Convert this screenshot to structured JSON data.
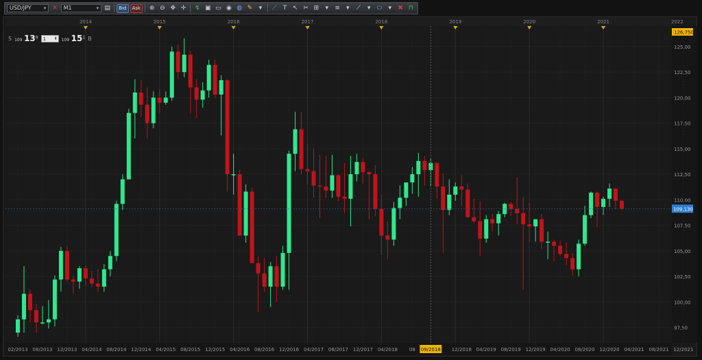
{
  "toolbar": {
    "symbol": "USD/JPY",
    "timeframe": "M1",
    "bid_label": "Bid",
    "ask_label": "Ask"
  },
  "price_panel": {
    "sell_label": "S",
    "sell_prefix": "109",
    "sell_big": "13",
    "sell_small": "9",
    "lots": "1",
    "buy_prefix": "109",
    "buy_big": "15",
    "buy_small": "1",
    "buy_label": "B"
  },
  "colors": {
    "bull": "#2ee88e",
    "bear": "#c0141b",
    "grid": "#2a2a2a",
    "current_price_tag": "#2f7fd0",
    "top_price_tag": "#f0b400",
    "cursor_date_tag": "#f0b400"
  },
  "chart_data": {
    "type": "candlestick",
    "timeframe": "monthly",
    "ylim": [
      96.0,
      127.0
    ],
    "y_ticks": [
      97.5,
      100.0,
      102.5,
      105.0,
      107.5,
      110.0,
      112.5,
      115.0,
      117.5,
      120.0,
      122.5,
      125.0
    ],
    "y_tick_labels": [
      "97,50",
      "100,00",
      "102,50",
      "105,00",
      "107,50",
      "110,00",
      "112,50",
      "115,00",
      "117,50",
      "120,00",
      "122,50",
      "125,00"
    ],
    "top_price_label": "126,750",
    "current_price": 109.13,
    "current_price_label": "109,130",
    "cursor_date_label": "09/2018",
    "year_labels": [
      "2014",
      "2015",
      "2016",
      "2017",
      "2018",
      "2019",
      "2020",
      "2021",
      "2022"
    ],
    "x_date_labels": [
      "02/2013",
      "08/2013",
      "12/2013",
      "04/2014",
      "08/2014",
      "12/2014",
      "04/2015",
      "08/2015",
      "12/2015",
      "04/2016",
      "08/2016",
      "12/2016",
      "04/2017",
      "08/2017",
      "12/2017",
      "04/2018",
      "08",
      "",
      "12/2018",
      "04/2019",
      "08/2019",
      "12/2019",
      "04/2020",
      "08/2020",
      "12/2020",
      "04/2021",
      "08/2021",
      "12/2021"
    ],
    "candles": [
      {
        "o": 97.0,
        "h": 98.7,
        "l": 96.6,
        "c": 98.3
      },
      {
        "o": 98.3,
        "h": 103.5,
        "l": 97.0,
        "c": 100.8
      },
      {
        "o": 100.8,
        "h": 101.2,
        "l": 98.0,
        "c": 99.2
      },
      {
        "o": 99.2,
        "h": 99.8,
        "l": 97.0,
        "c": 98.0
      },
      {
        "o": 98.0,
        "h": 99.6,
        "l": 97.8,
        "c": 98.0
      },
      {
        "o": 98.0,
        "h": 100.2,
        "l": 97.4,
        "c": 98.3
      },
      {
        "o": 98.3,
        "h": 102.6,
        "l": 97.6,
        "c": 102.2
      },
      {
        "o": 102.2,
        "h": 105.4,
        "l": 101.0,
        "c": 105.0
      },
      {
        "o": 105.0,
        "h": 105.5,
        "l": 102.0,
        "c": 102.2
      },
      {
        "o": 102.2,
        "h": 102.6,
        "l": 100.8,
        "c": 102.0
      },
      {
        "o": 102.0,
        "h": 103.5,
        "l": 101.3,
        "c": 103.3
      },
      {
        "o": 103.3,
        "h": 103.6,
        "l": 101.6,
        "c": 102.3
      },
      {
        "o": 102.3,
        "h": 103.0,
        "l": 101.5,
        "c": 101.8
      },
      {
        "o": 101.8,
        "h": 103.2,
        "l": 101.0,
        "c": 101.5
      },
      {
        "o": 101.5,
        "h": 103.7,
        "l": 101.0,
        "c": 103.2
      },
      {
        "o": 103.2,
        "h": 105.0,
        "l": 102.5,
        "c": 104.5
      },
      {
        "o": 104.5,
        "h": 109.9,
        "l": 104.0,
        "c": 109.6
      },
      {
        "o": 109.6,
        "h": 112.5,
        "l": 109.0,
        "c": 112.0
      },
      {
        "o": 112.0,
        "h": 118.9,
        "l": 112.0,
        "c": 118.5
      },
      {
        "o": 118.5,
        "h": 121.8,
        "l": 116.0,
        "c": 120.5
      },
      {
        "o": 120.5,
        "h": 121.7,
        "l": 118.1,
        "c": 119.3
      },
      {
        "o": 119.3,
        "h": 121.0,
        "l": 116.0,
        "c": 117.5
      },
      {
        "o": 117.5,
        "h": 120.6,
        "l": 117.0,
        "c": 120.0
      },
      {
        "o": 120.0,
        "h": 120.8,
        "l": 118.5,
        "c": 119.5
      },
      {
        "o": 119.5,
        "h": 120.6,
        "l": 119.3,
        "c": 120.0
      },
      {
        "o": 120.0,
        "h": 125.0,
        "l": 119.7,
        "c": 124.5
      },
      {
        "o": 124.5,
        "h": 125.2,
        "l": 121.8,
        "c": 122.5
      },
      {
        "o": 122.5,
        "h": 125.8,
        "l": 122.0,
        "c": 124.2
      },
      {
        "o": 124.2,
        "h": 124.6,
        "l": 118.5,
        "c": 121.0
      },
      {
        "o": 121.0,
        "h": 121.8,
        "l": 118.0,
        "c": 119.8
      },
      {
        "o": 119.8,
        "h": 121.5,
        "l": 119.0,
        "c": 120.7
      },
      {
        "o": 120.7,
        "h": 123.7,
        "l": 120.0,
        "c": 123.2
      },
      {
        "o": 123.2,
        "h": 123.7,
        "l": 120.0,
        "c": 120.3
      },
      {
        "o": 120.3,
        "h": 122.2,
        "l": 116.3,
        "c": 121.7
      },
      {
        "o": 121.7,
        "h": 121.8,
        "l": 110.8,
        "c": 112.5
      },
      {
        "o": 112.5,
        "h": 114.5,
        "l": 110.5,
        "c": 112.5
      },
      {
        "o": 112.5,
        "h": 113.0,
        "l": 106.5,
        "c": 106.5
      },
      {
        "o": 106.5,
        "h": 111.5,
        "l": 105.8,
        "c": 110.8
      },
      {
        "o": 110.8,
        "h": 111.2,
        "l": 103.8,
        "c": 103.8
      },
      {
        "o": 103.8,
        "h": 104.5,
        "l": 99.0,
        "c": 102.8
      },
      {
        "o": 102.8,
        "h": 104.3,
        "l": 101.0,
        "c": 101.5
      },
      {
        "o": 101.5,
        "h": 103.9,
        "l": 99.5,
        "c": 103.5
      },
      {
        "o": 103.5,
        "h": 104.5,
        "l": 100.0,
        "c": 101.5
      },
      {
        "o": 101.5,
        "h": 105.5,
        "l": 101.2,
        "c": 104.8
      },
      {
        "o": 104.8,
        "h": 114.8,
        "l": 101.2,
        "c": 114.5
      },
      {
        "o": 114.5,
        "h": 118.6,
        "l": 112.8,
        "c": 116.9
      },
      {
        "o": 116.9,
        "h": 118.6,
        "l": 112.5,
        "c": 113.0
      },
      {
        "o": 113.0,
        "h": 115.5,
        "l": 111.5,
        "c": 112.8
      },
      {
        "o": 112.8,
        "h": 115.0,
        "l": 110.2,
        "c": 111.4
      },
      {
        "o": 111.4,
        "h": 114.4,
        "l": 108.2,
        "c": 111.3
      },
      {
        "o": 111.3,
        "h": 114.3,
        "l": 110.2,
        "c": 110.9
      },
      {
        "o": 110.9,
        "h": 114.4,
        "l": 110.2,
        "c": 112.4
      },
      {
        "o": 112.4,
        "h": 112.5,
        "l": 109.9,
        "c": 110.3
      },
      {
        "o": 110.3,
        "h": 113.6,
        "l": 108.7,
        "c": 110.1
      },
      {
        "o": 110.1,
        "h": 114.3,
        "l": 107.4,
        "c": 112.5
      },
      {
        "o": 112.5,
        "h": 114.5,
        "l": 111.8,
        "c": 113.7
      },
      {
        "o": 113.7,
        "h": 114.1,
        "l": 111.6,
        "c": 112.7
      },
      {
        "o": 112.7,
        "h": 112.8,
        "l": 108.1,
        "c": 112.5
      },
      {
        "o": 112.5,
        "h": 113.4,
        "l": 108.4,
        "c": 109.1
      },
      {
        "o": 109.1,
        "h": 110.5,
        "l": 104.6,
        "c": 106.5
      },
      {
        "o": 106.5,
        "h": 107.9,
        "l": 104.2,
        "c": 106.1
      },
      {
        "o": 106.1,
        "h": 109.8,
        "l": 105.5,
        "c": 109.2
      },
      {
        "o": 109.2,
        "h": 111.4,
        "l": 108.1,
        "c": 110.2
      },
      {
        "o": 110.2,
        "h": 111.3,
        "l": 109.4,
        "c": 111.7
      },
      {
        "o": 111.7,
        "h": 113.2,
        "l": 110.6,
        "c": 112.5
      },
      {
        "o": 112.5,
        "h": 114.6,
        "l": 110.3,
        "c": 113.8
      },
      {
        "o": 113.8,
        "h": 114.3,
        "l": 111.4,
        "c": 112.9
      },
      {
        "o": 112.9,
        "h": 114.0,
        "l": 111.3,
        "c": 113.6
      },
      {
        "o": 113.6,
        "h": 113.7,
        "l": 110.1,
        "c": 111.3
      },
      {
        "o": 111.3,
        "h": 112.6,
        "l": 104.8,
        "c": 109.0
      },
      {
        "o": 109.0,
        "h": 112.0,
        "l": 108.5,
        "c": 110.5
      },
      {
        "o": 110.5,
        "h": 111.7,
        "l": 109.9,
        "c": 111.3
      },
      {
        "o": 111.3,
        "h": 112.4,
        "l": 109.4,
        "c": 111.0
      },
      {
        "o": 111.0,
        "h": 111.6,
        "l": 108.2,
        "c": 108.3
      },
      {
        "o": 108.3,
        "h": 110.1,
        "l": 107.7,
        "c": 107.9
      },
      {
        "o": 107.9,
        "h": 109.9,
        "l": 104.5,
        "c": 106.2
      },
      {
        "o": 106.2,
        "h": 108.5,
        "l": 105.8,
        "c": 108.1
      },
      {
        "o": 108.1,
        "h": 108.6,
        "l": 106.9,
        "c": 107.7
      },
      {
        "o": 107.7,
        "h": 108.9,
        "l": 106.5,
        "c": 108.6
      },
      {
        "o": 108.6,
        "h": 109.7,
        "l": 108.3,
        "c": 109.6
      },
      {
        "o": 109.6,
        "h": 109.8,
        "l": 108.4,
        "c": 109.1
      },
      {
        "o": 109.1,
        "h": 112.2,
        "l": 107.6,
        "c": 108.7
      },
      {
        "o": 108.7,
        "h": 110.3,
        "l": 101.2,
        "c": 107.6
      },
      {
        "o": 107.6,
        "h": 109.7,
        "l": 105.9,
        "c": 107.4
      },
      {
        "o": 107.4,
        "h": 108.1,
        "l": 105.9,
        "c": 108.1
      },
      {
        "o": 108.1,
        "h": 108.6,
        "l": 105.2,
        "c": 105.9
      },
      {
        "o": 105.9,
        "h": 106.9,
        "l": 104.2,
        "c": 105.9
      },
      {
        "o": 105.9,
        "h": 106.1,
        "l": 104.0,
        "c": 105.5
      },
      {
        "o": 105.5,
        "h": 106.0,
        "l": 104.5,
        "c": 104.7
      },
      {
        "o": 104.7,
        "h": 105.8,
        "l": 103.6,
        "c": 104.3
      },
      {
        "o": 104.3,
        "h": 104.8,
        "l": 102.6,
        "c": 103.2
      },
      {
        "o": 103.2,
        "h": 106.1,
        "l": 102.5,
        "c": 105.7
      },
      {
        "o": 105.7,
        "h": 109.4,
        "l": 105.5,
        "c": 108.5
      },
      {
        "o": 108.5,
        "h": 110.8,
        "l": 108.2,
        "c": 110.7
      },
      {
        "o": 110.7,
        "h": 110.8,
        "l": 107.3,
        "c": 109.3
      },
      {
        "o": 109.3,
        "h": 110.3,
        "l": 108.5,
        "c": 110.1
      },
      {
        "o": 110.1,
        "h": 111.6,
        "l": 109.3,
        "c": 111.1
      },
      {
        "o": 111.1,
        "h": 111.1,
        "l": 109.1,
        "c": 109.9
      },
      {
        "o": 109.9,
        "h": 110.0,
        "l": 109.0,
        "c": 109.13
      }
    ]
  }
}
